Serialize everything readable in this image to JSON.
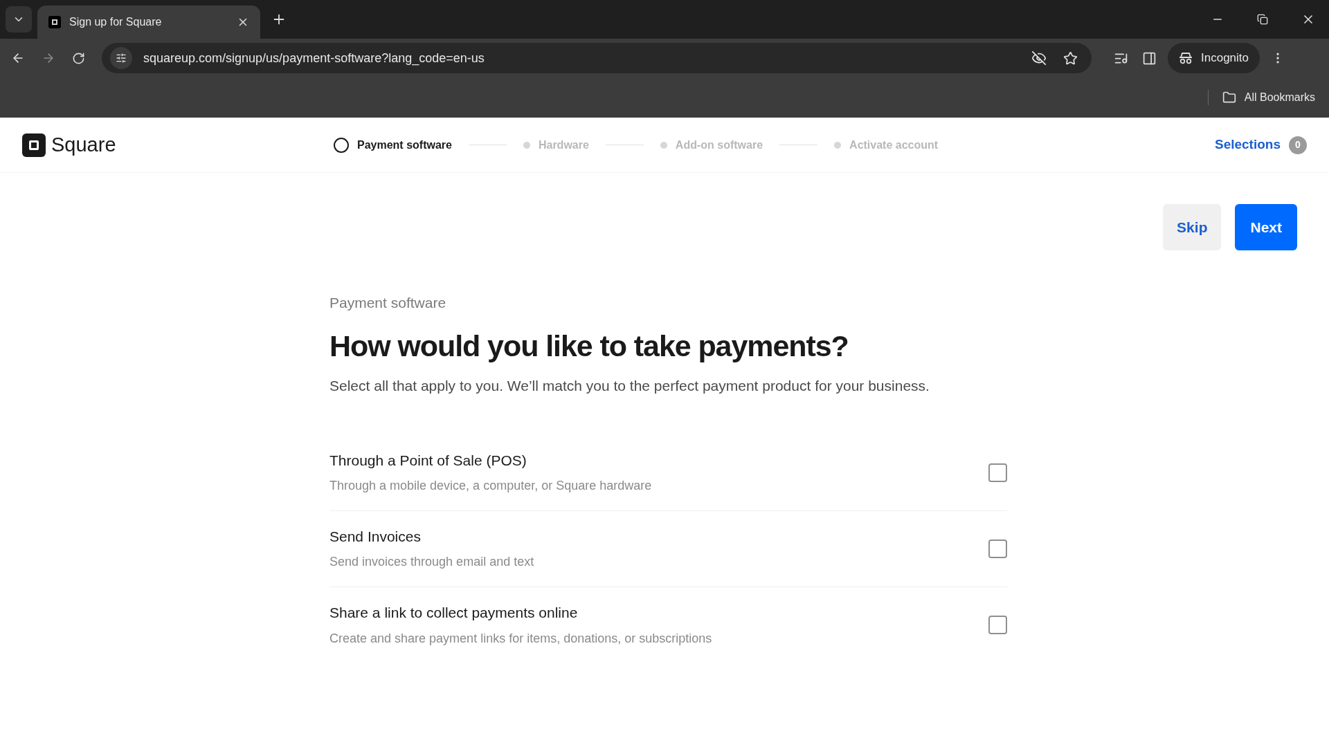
{
  "browser": {
    "tab_title": "Sign up for Square",
    "url": "squareup.com/signup/us/payment-software?lang_code=en-us",
    "profile": "Incognito",
    "bookmarks_label": "All Bookmarks"
  },
  "header": {
    "logo": "Square",
    "steps": [
      {
        "label": "Payment software",
        "selected": true
      },
      {
        "label": "Hardware",
        "selected": false
      },
      {
        "label": "Add-on software",
        "selected": false
      },
      {
        "label": "Activate account",
        "selected": false
      }
    ],
    "selections_label": "Selections",
    "selections_count": "0"
  },
  "actions": {
    "skip": "Skip",
    "next": "Next"
  },
  "content": {
    "eyebrow": "Payment software",
    "title": "How would you like to take payments?",
    "subtitle": "Select all that apply to you. We’ll match you to the perfect payment product for your business.",
    "options": [
      {
        "title": "Through a Point of Sale (POS)",
        "description": "Through a mobile device, a computer, or Square hardware",
        "checked": false
      },
      {
        "title": "Send Invoices",
        "description": "Send invoices through email and text",
        "checked": false
      },
      {
        "title": "Share a link to collect payments online",
        "description": "Create and share payment links for items, donations, or subscriptions",
        "checked": false
      }
    ]
  }
}
